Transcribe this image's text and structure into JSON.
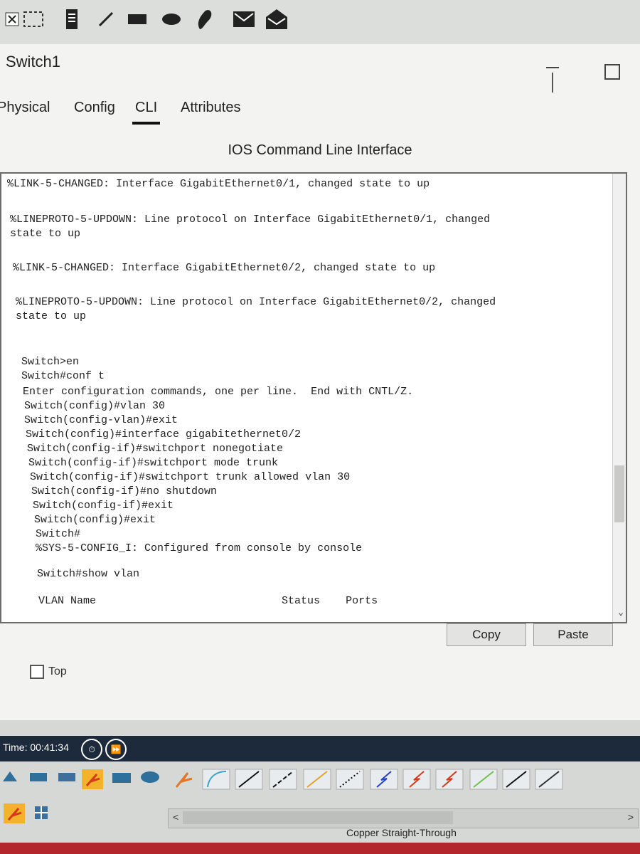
{
  "toolbar": {
    "icons": [
      "close-icon",
      "select-icon",
      "inspect-icon",
      "line-tool-icon",
      "rectangle-icon",
      "ellipse-icon",
      "freeform-icon",
      "mail-icon",
      "open-envelope-icon"
    ]
  },
  "window": {
    "title": "Switch1",
    "tabs": [
      {
        "label": "Physical",
        "active": false
      },
      {
        "label": "Config",
        "active": false
      },
      {
        "label": "CLI",
        "active": true
      },
      {
        "label": "Attributes",
        "active": false
      }
    ],
    "heading": "IOS Command Line Interface"
  },
  "terminal": {
    "lines": [
      "%LINK-5-CHANGED: Interface GigabitEthernet0/1, changed state to up",
      "%LINEPROTO-5-UPDOWN: Line protocol on Interface GigabitEthernet0/1, changed",
      "state to up",
      "%LINK-5-CHANGED: Interface GigabitEthernet0/2, changed state to up",
      "%LINEPROTO-5-UPDOWN: Line protocol on Interface GigabitEthernet0/2, changed",
      "state to up",
      "Switch>en",
      "Switch#conf t",
      "Enter configuration commands, one per line.  End with CNTL/Z.",
      "Switch(config)#vlan 30",
      "Switch(config-vlan)#exit",
      "Switch(config)#interface gigabitethernet0/2",
      "Switch(config-if)#switchport nonegotiate",
      "Switch(config-if)#switchport mode trunk",
      "Switch(config-if)#switchport trunk allowed vlan 30",
      "Switch(config-if)#no shutdown",
      "Switch(config-if)#exit",
      "Switch(config)#exit",
      "Switch#",
      "%SYS-5-CONFIG_I: Configured from console by console",
      "Switch#show vlan",
      "VLAN Name                             Status    Ports"
    ]
  },
  "buttons": {
    "copy": "Copy",
    "paste": "Paste"
  },
  "top_checkbox": {
    "label": "Top",
    "checked": false
  },
  "bottom": {
    "time": "Time: 00:41:34",
    "status": "Copper Straight-Through"
  }
}
